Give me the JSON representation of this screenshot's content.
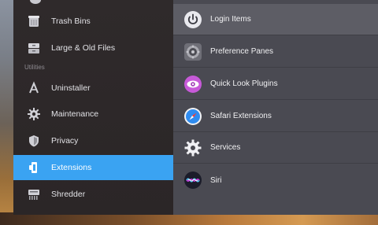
{
  "sidebar": {
    "section_label": "Utilities",
    "items": [
      {
        "label": "Trash Bins",
        "icon": "trash-bins-icon"
      },
      {
        "label": "Large & Old Files",
        "icon": "file-cabinet-icon"
      },
      {
        "label": "Uninstaller",
        "icon": "uninstaller-icon"
      },
      {
        "label": "Maintenance",
        "icon": "gear-icon"
      },
      {
        "label": "Privacy",
        "icon": "shield-icon"
      },
      {
        "label": "Extensions",
        "icon": "extensions-icon",
        "active": true
      },
      {
        "label": "Shredder",
        "icon": "shredder-icon"
      }
    ]
  },
  "main": {
    "items": [
      {
        "label": "Login Items",
        "icon": "power-icon",
        "selected": true
      },
      {
        "label": "Preference Panes",
        "icon": "system-preferences-icon"
      },
      {
        "label": "Quick Look Plugins",
        "icon": "eye-icon"
      },
      {
        "label": "Safari Extensions",
        "icon": "safari-compass-icon"
      },
      {
        "label": "Services",
        "icon": "gear-icon"
      },
      {
        "label": "Siri",
        "icon": "siri-icon"
      }
    ]
  },
  "colors": {
    "accent": "#3aa3f2",
    "sidebar_bg": "#2d2829",
    "main_bg": "#4a4a52"
  }
}
